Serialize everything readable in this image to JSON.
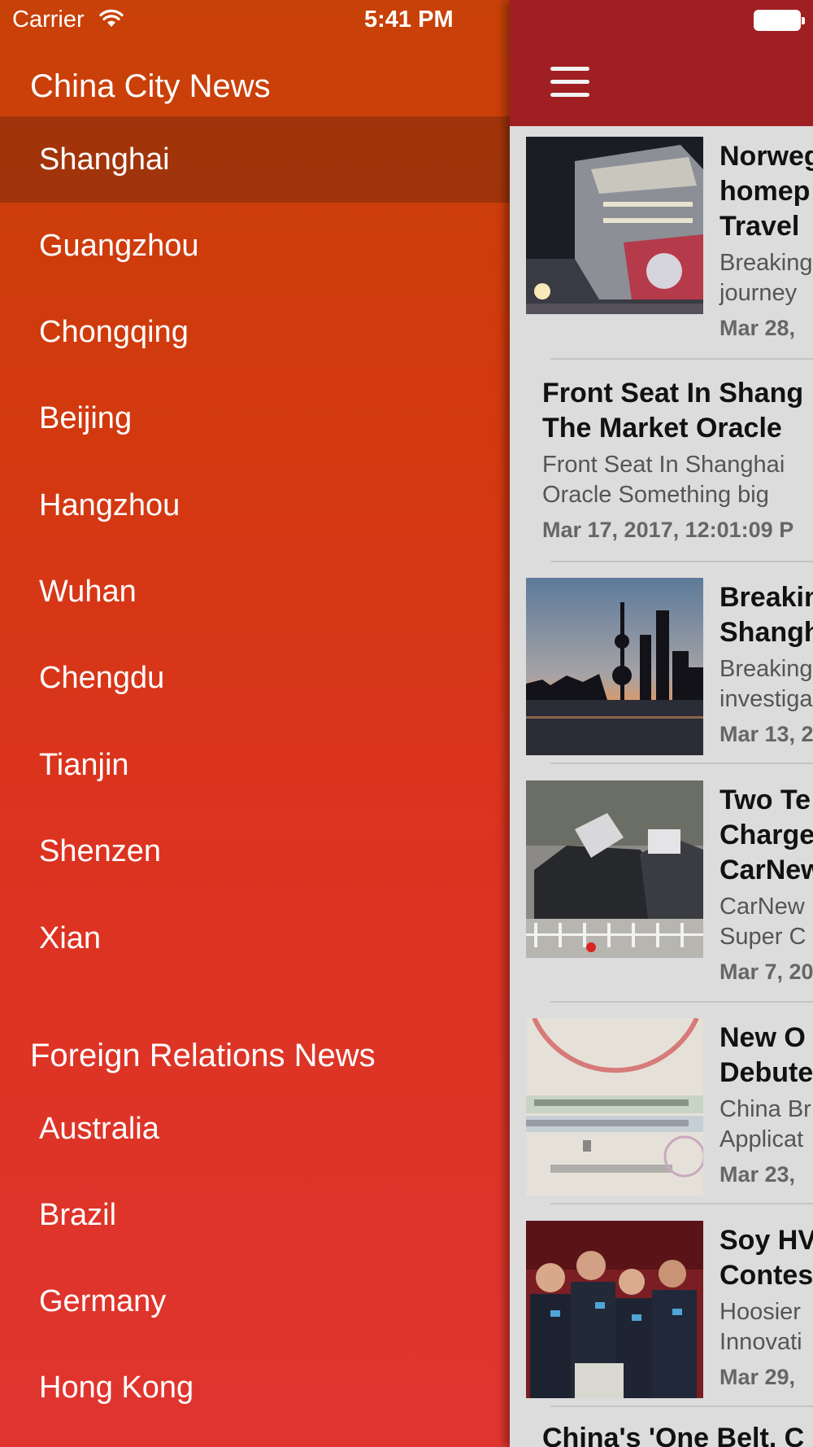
{
  "status_bar": {
    "carrier": "Carrier",
    "time": "5:41 PM"
  },
  "drawer": {
    "city_section_title": "China City News",
    "cities": [
      "Shanghai",
      "Guangzhou",
      "Chongqing",
      "Beijing",
      "Hangzhou",
      "Wuhan",
      "Chengdu",
      "Tianjin",
      "Shenzen",
      "Xian"
    ],
    "selected_city": "Shanghai",
    "foreign_section_title": "Foreign Relations News",
    "countries": [
      "Australia",
      "Brazil",
      "Germany",
      "Hong Kong"
    ]
  },
  "colors": {
    "drawer_top": "#c84108",
    "drawer_bottom": "#e0352f",
    "navbar": "#a01f22",
    "selected_row": "#953a18"
  },
  "icons": {
    "menu": "hamburger-icon",
    "wifi": "wifi-icon",
    "battery": "battery-icon"
  },
  "articles": [
    {
      "title_lines": [
        "Norweg",
        "homep",
        "Travel"
      ],
      "snippet_lines": [
        "Breaking",
        "journey"
      ],
      "date": "Mar 28,",
      "image": "cruise-ship-thumbnail"
    },
    {
      "title_lines": [
        "Front Seat In Shang",
        "The Market Oracle"
      ],
      "snippet_lines": [
        "Front Seat In Shanghai",
        "Oracle  Something big"
      ],
      "date": "Mar 17, 2017, 12:01:09 P",
      "image": ""
    },
    {
      "title_lines": [
        "Breakin",
        "Shangh"
      ],
      "snippet_lines": [
        "Breaking",
        "investiga"
      ],
      "date": "Mar 13, 2",
      "image": "shanghai-skyline-thumbnail"
    },
    {
      "title_lines": [
        "Two Te",
        "Charge",
        "CarNew"
      ],
      "snippet_lines": [
        "CarNew",
        "Super C"
      ],
      "date": "Mar 7, 20",
      "image": "tesla-cars-thumbnail"
    },
    {
      "title_lines": [
        "New O",
        "Debute"
      ],
      "snippet_lines": [
        "China Br",
        "Applicat"
      ],
      "date": "Mar 23,",
      "image": "chinese-visa-thumbnail"
    },
    {
      "title_lines": [
        "Soy HV",
        "Contes"
      ],
      "snippet_lines": [
        "Hoosier",
        "Innovati"
      ],
      "date": "Mar 29,",
      "image": "team-photo-thumbnail"
    },
    {
      "title_lines": [
        "China's 'One Belt, C"
      ],
      "snippet_lines": [],
      "date": "",
      "image": ""
    }
  ]
}
